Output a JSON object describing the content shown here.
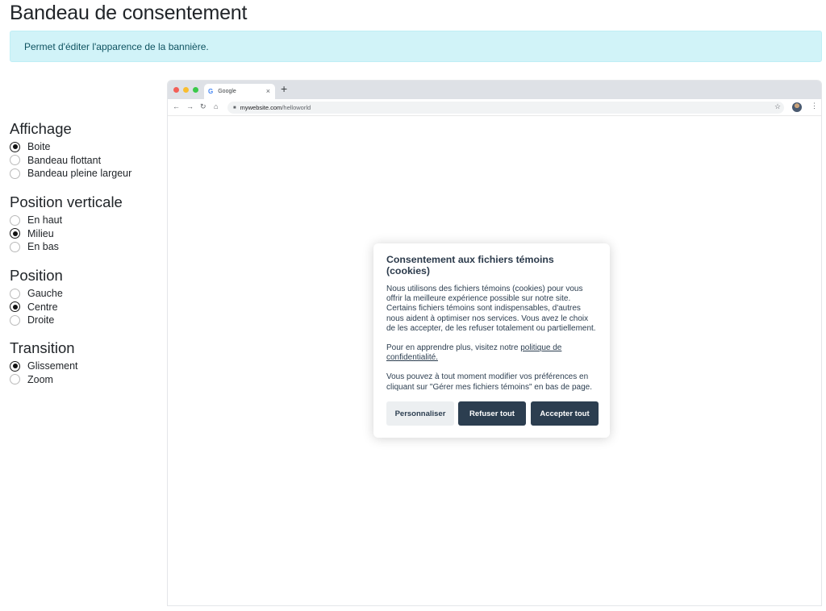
{
  "page": {
    "title": "Bandeau de consentement",
    "info": "Permet d'éditer l'apparence de la bannière."
  },
  "options": {
    "affichage": {
      "title": "Affichage",
      "items": [
        {
          "label": "Boite",
          "checked": true
        },
        {
          "label": "Bandeau flottant",
          "checked": false
        },
        {
          "label": "Bandeau pleine largeur",
          "checked": false
        }
      ]
    },
    "position_verticale": {
      "title": "Position verticale",
      "items": [
        {
          "label": "En haut",
          "checked": false
        },
        {
          "label": "Milieu",
          "checked": true
        },
        {
          "label": "En bas",
          "checked": false
        }
      ]
    },
    "position": {
      "title": "Position",
      "items": [
        {
          "label": "Gauche",
          "checked": false
        },
        {
          "label": "Centre",
          "checked": true
        },
        {
          "label": "Droite",
          "checked": false
        }
      ]
    },
    "transition": {
      "title": "Transition",
      "items": [
        {
          "label": "Glissement",
          "checked": true
        },
        {
          "label": "Zoom",
          "checked": false
        }
      ]
    }
  },
  "browser": {
    "tab_title": "Google",
    "tab_icon": "G",
    "close_glyph": "×",
    "new_tab_glyph": "+",
    "url_domain": "mywebsite.com",
    "url_path": "/helloworld",
    "icons": [
      "back-icon",
      "forward-icon",
      "reload-icon",
      "home-icon",
      "lock-icon",
      "star-icon",
      "avatar",
      "menu-icon"
    ]
  },
  "modal": {
    "title": "Consentement aux fichiers témoins (cookies)",
    "paragraph1": "Nous utilisons des fichiers témoins (cookies) pour vous offrir la meilleure expérience possible sur notre site. Certains fichiers témoins sont indispensables, d'autres nous aident à optimiser nos services. Vous avez le choix de les accepter, de les refuser totalement ou partiellement.",
    "paragraph2_prefix": "Pour en apprendre plus, visitez notre ",
    "privacy_link": "politique de confidentialité.",
    "paragraph3": "Vous pouvez à tout moment modifier vos préférences en cliquant sur \"Gérer mes fichiers témoins\" en bas de page.",
    "btn_customize": "Personnaliser",
    "btn_refuse": "Refuser tout",
    "btn_accept": "Accepter tout"
  },
  "colors": {
    "alert_bg": "#d1f3f8",
    "alert_text": "#0e5260",
    "modal_dark": "#2c3e50",
    "modal_light": "#eceff1"
  }
}
